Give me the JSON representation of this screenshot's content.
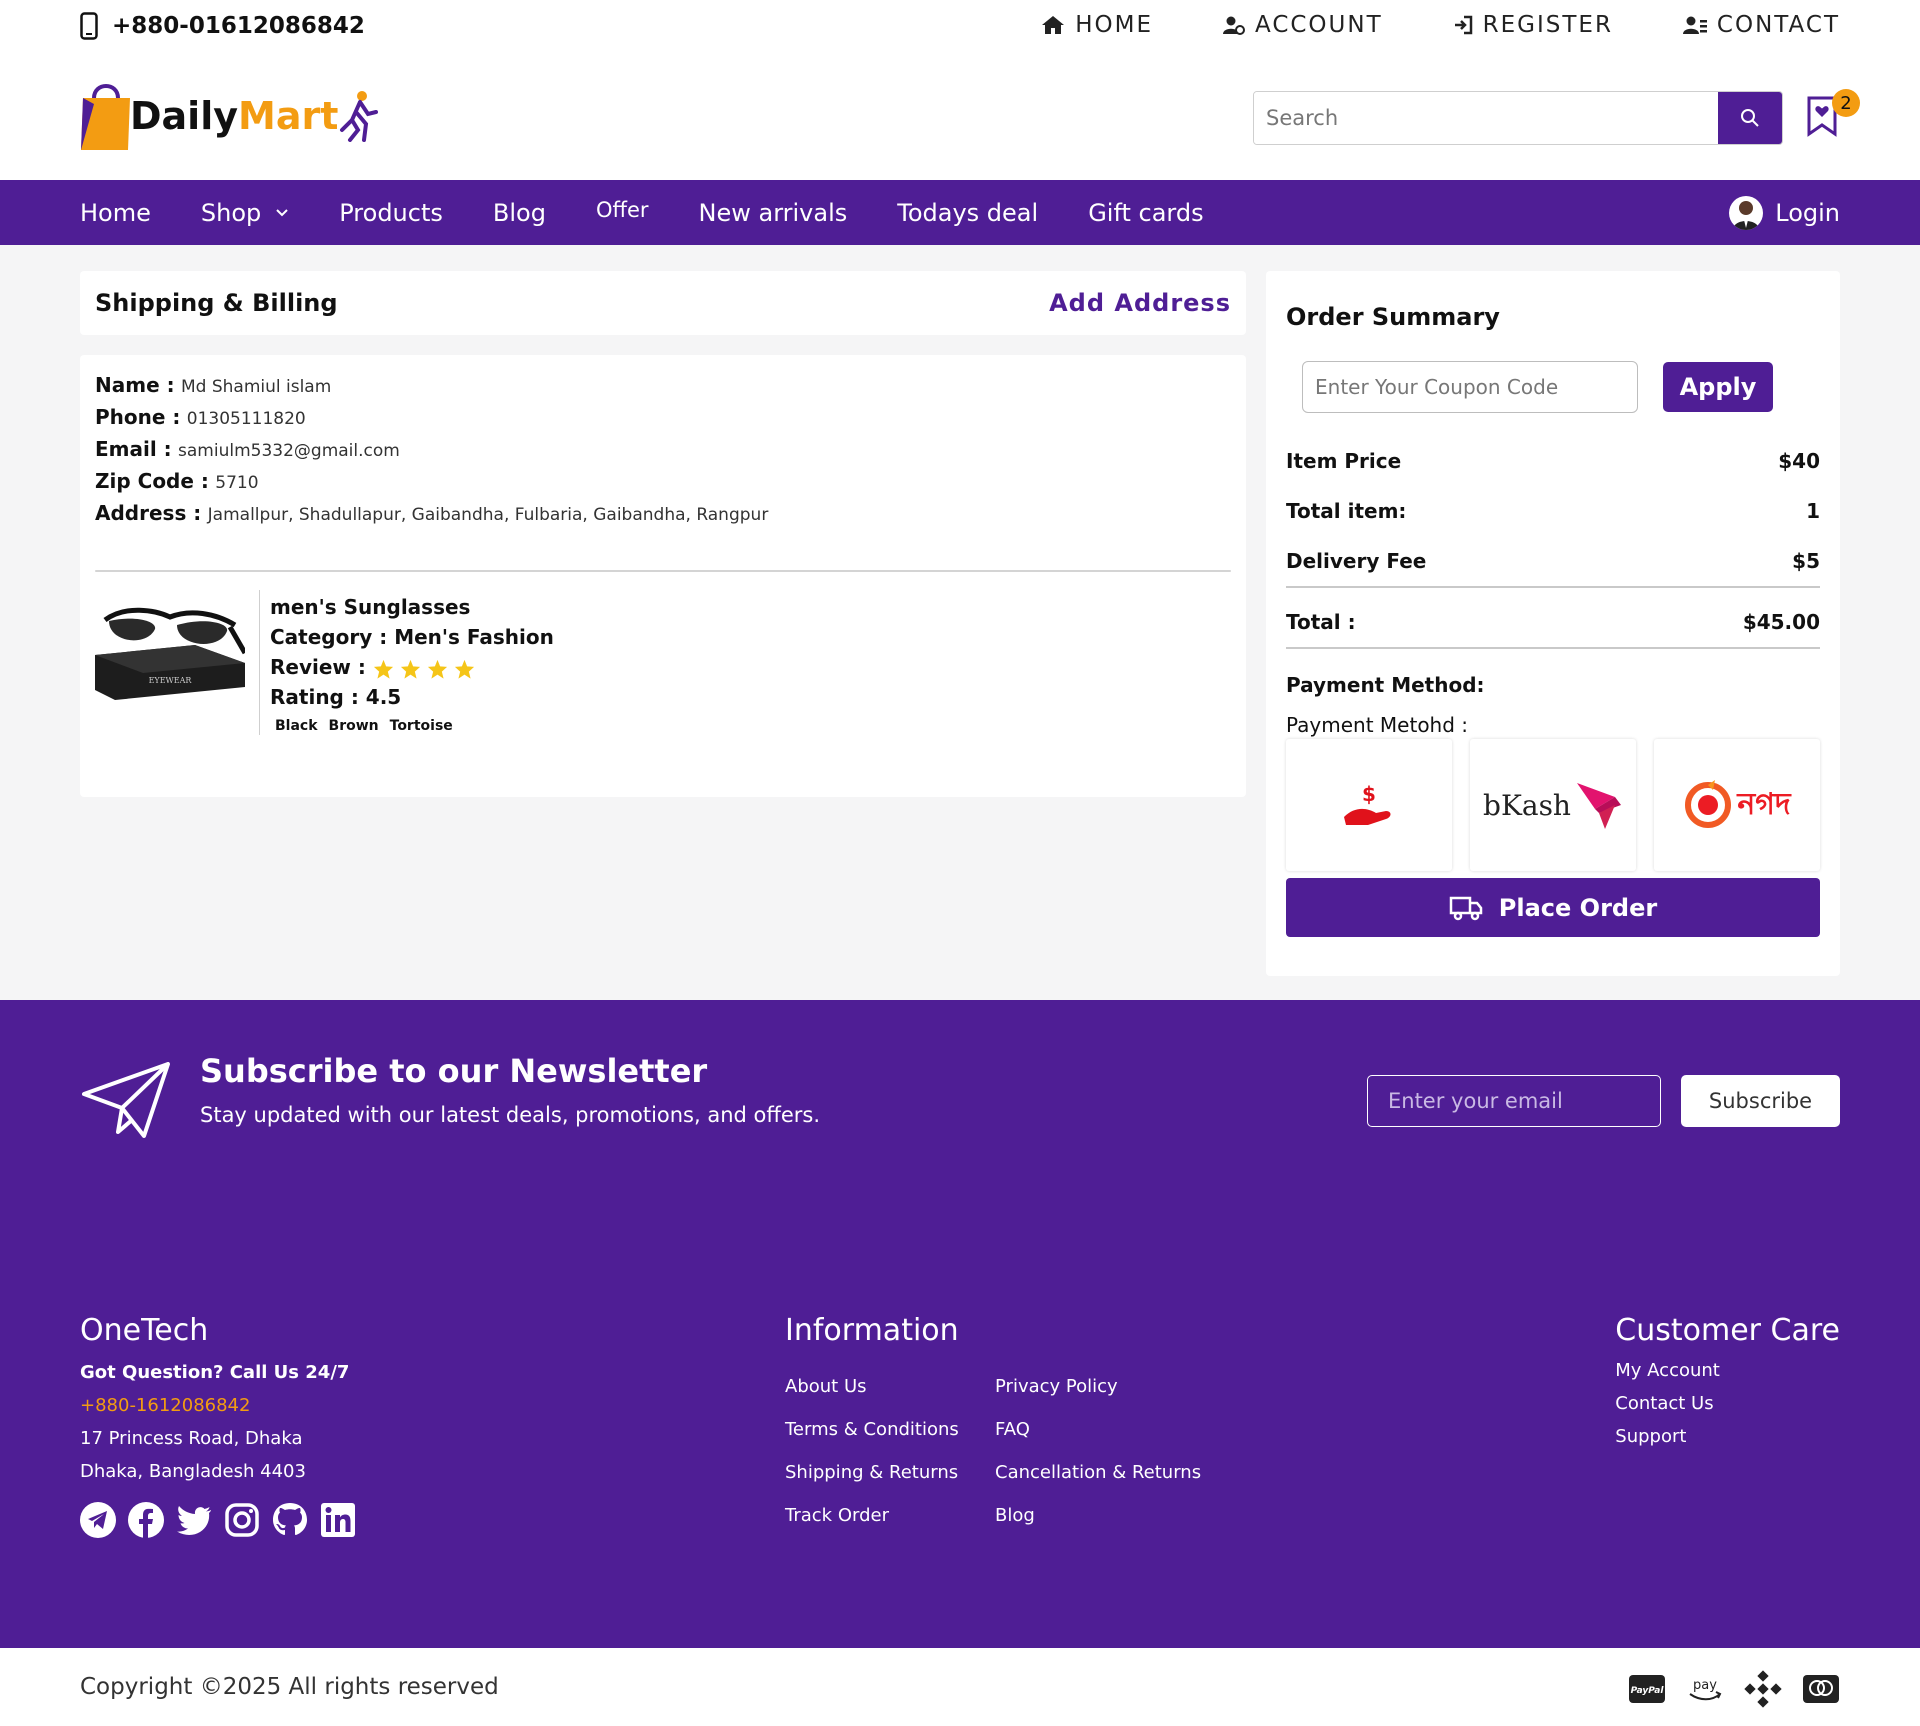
{
  "topbar": {
    "phone": "+880-01612086842",
    "nav": [
      "HOME",
      "ACCOUNT",
      "REGISTER",
      "CONTACT"
    ]
  },
  "logo": {
    "part1": "Daily",
    "part2": "Mart"
  },
  "search": {
    "placeholder": "Search"
  },
  "wishlist": {
    "count": "2"
  },
  "mainnav": {
    "items": [
      "Home",
      "Shop",
      "Products",
      "Blog",
      "Offer",
      "New arrivals",
      "Todays deal",
      "Gift cards"
    ],
    "login": "Login"
  },
  "shipping": {
    "title": "Shipping & Billing",
    "add_address": "Add Address",
    "fields": [
      {
        "label": "Name :",
        "value": "Md Shamiul islam"
      },
      {
        "label": "Phone :",
        "value": "01305111820"
      },
      {
        "label": "Email :",
        "value": "samiulm5332@gmail.com"
      },
      {
        "label": "Zip Code :",
        "value": "5710"
      },
      {
        "label": "Address :",
        "value": "Jamallpur, Shadullapur, Gaibandha, Fulbaria, Gaibandha, Rangpur"
      }
    ]
  },
  "product": {
    "name": "men's Sunglasses",
    "category_label": "Category :",
    "category": "Men's Fashion",
    "review_label": "Review :",
    "review_stars": 4,
    "rating_label": "Rating :",
    "rating": "4.5",
    "colors": [
      "Black",
      "Brown",
      "Tortoise"
    ],
    "box_text": "EYEWEAR"
  },
  "summary": {
    "title": "Order Summary",
    "coupon_placeholder": "Enter Your Coupon Code",
    "apply": "Apply",
    "item_price_label": "Item Price",
    "item_price": "$40",
    "total_item_label": "Total item:",
    "total_item": "1",
    "delivery_label": "Delivery Fee",
    "delivery": "$5",
    "total_label": "Total :",
    "total": "$45.00",
    "payment_method": "Payment Method:",
    "payment_sub": "Payment Metohd :",
    "methods": [
      "Cash on Delivery",
      "bKash",
      "Nagad"
    ],
    "bkash_text": "bKash",
    "nagad_text": "নগদ",
    "place_order": "Place Order"
  },
  "newsletter": {
    "title": "Subscribe to our Newsletter",
    "subtitle": "Stay updated with our latest deals, promotions, and offers.",
    "placeholder": "Enter your email",
    "button": "Subscribe"
  },
  "footer": {
    "brand": "OneTech",
    "question": "Got Question? Call Us 24/7",
    "phone": "+880-1612086842",
    "address1": "17 Princess Road, Dhaka",
    "address2": "Dhaka, Bangladesh 4403",
    "info_title": "Information",
    "info_links": [
      "About Us",
      "Privacy Policy",
      "Terms & Conditions",
      "FAQ",
      "Shipping & Returns",
      "Cancellation & Returns",
      "Track Order",
      "Blog"
    ],
    "care_title": "Customer Care",
    "care_links": [
      "My Account",
      "Contact Us",
      "Support"
    ]
  },
  "copyright": "Copyright ©2025 All rights reserved",
  "payment_icons": [
    "paypal-icon",
    "amazon-pay-icon",
    "binance-icon",
    "mastercard-icon"
  ],
  "colors": {
    "primary": "#4f1e95",
    "accent": "#f39c12",
    "star": "#f5c518"
  }
}
